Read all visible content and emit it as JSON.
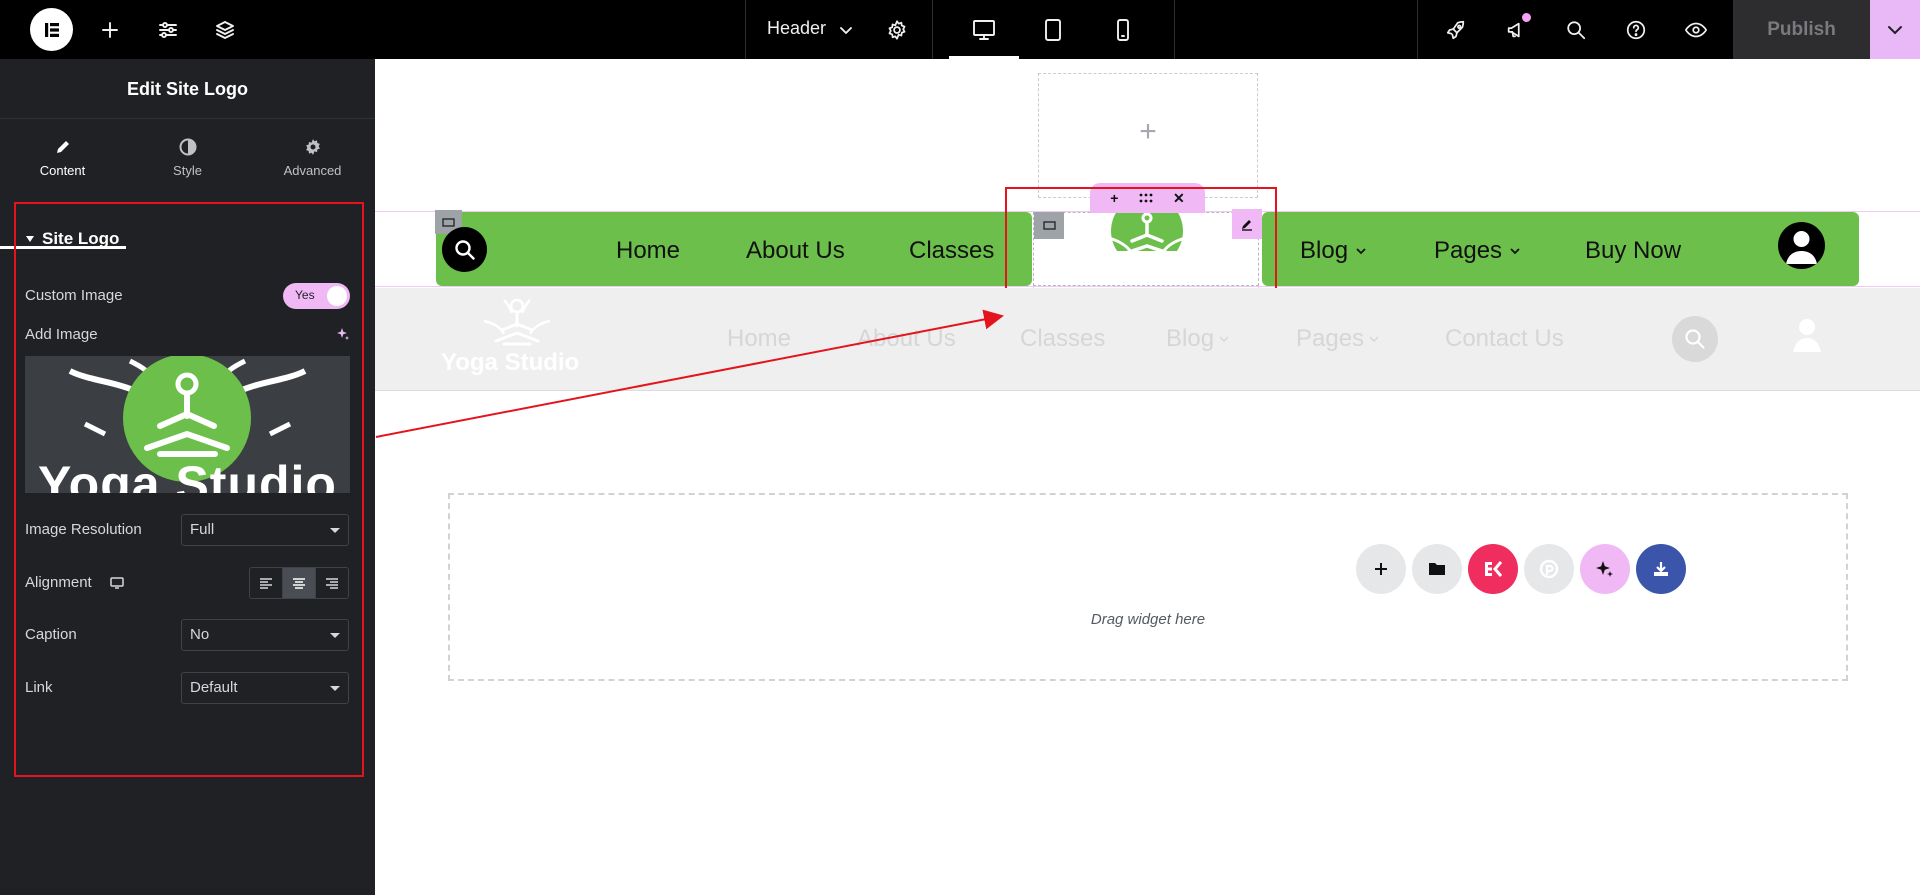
{
  "topbar": {
    "document_title": "Header",
    "publish_label": "Publish"
  },
  "panel": {
    "title": "Edit Site Logo",
    "tabs": [
      {
        "label": "Content",
        "icon": "pencil-icon",
        "active": true
      },
      {
        "label": "Style",
        "icon": "half-circle-icon",
        "active": false
      },
      {
        "label": "Advanced",
        "icon": "gear-icon",
        "active": false
      }
    ],
    "section_title": "Site Logo",
    "custom_image": {
      "label": "Custom Image",
      "value": "Yes"
    },
    "add_image": {
      "label": "Add Image",
      "preview_text": "Yoga Studio"
    },
    "image_resolution": {
      "label": "Image Resolution",
      "value": "Full"
    },
    "alignment": {
      "label": "Alignment",
      "selected": "center"
    },
    "caption": {
      "label": "Caption",
      "value": "No"
    },
    "link": {
      "label": "Link",
      "value": "Default"
    }
  },
  "canvas": {
    "green_nav": {
      "items_left": [
        "Home",
        "About Us",
        "Classes"
      ],
      "items_right": [
        {
          "label": "Blog",
          "has_dropdown": true
        },
        {
          "label": "Pages",
          "has_dropdown": true
        },
        {
          "label": "Buy Now",
          "has_dropdown": false
        }
      ]
    },
    "grey_header": {
      "logo_text": "Yoga Studio",
      "nav": [
        {
          "label": "Home",
          "has_dropdown": false
        },
        {
          "label": "About Us",
          "has_dropdown": false
        },
        {
          "label": "Classes",
          "has_dropdown": false
        },
        {
          "label": "Blog",
          "has_dropdown": true
        },
        {
          "label": "Pages",
          "has_dropdown": true
        },
        {
          "label": "Contact Us",
          "has_dropdown": false
        }
      ]
    },
    "dropzone": {
      "text": "Drag widget here"
    }
  },
  "colors": {
    "accent_pink": "#f0b9f5",
    "nav_green": "#6dbf4b",
    "highlight_red": "#e3141c",
    "editor_dark": "#1f2124"
  }
}
